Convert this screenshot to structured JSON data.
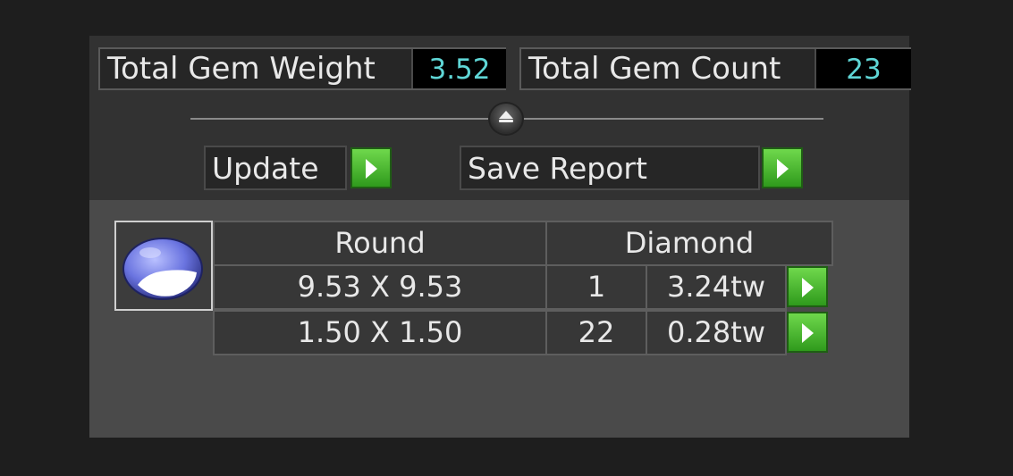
{
  "summary": {
    "weight_label": "Total Gem Weight",
    "weight_value": "3.52",
    "count_label": "Total Gem Count",
    "count_value": "23"
  },
  "actions": {
    "update_label": "Update",
    "save_label": "Save Report"
  },
  "gem_table": {
    "shape": "Round",
    "material": "Diamond",
    "rows": [
      {
        "size": "9.53 X 9.53",
        "count": "1",
        "weight": "3.24tw"
      },
      {
        "size": "1.50 X 1.50",
        "count": "22",
        "weight": "0.28tw"
      }
    ]
  },
  "icons": {
    "collapse": "chevron-up-icon",
    "play": "play-icon",
    "gem": "round-gem-icon"
  },
  "colors": {
    "value_text": "#5fd6d6",
    "play_button": "#3fae28",
    "gem": "#6a74e0"
  }
}
